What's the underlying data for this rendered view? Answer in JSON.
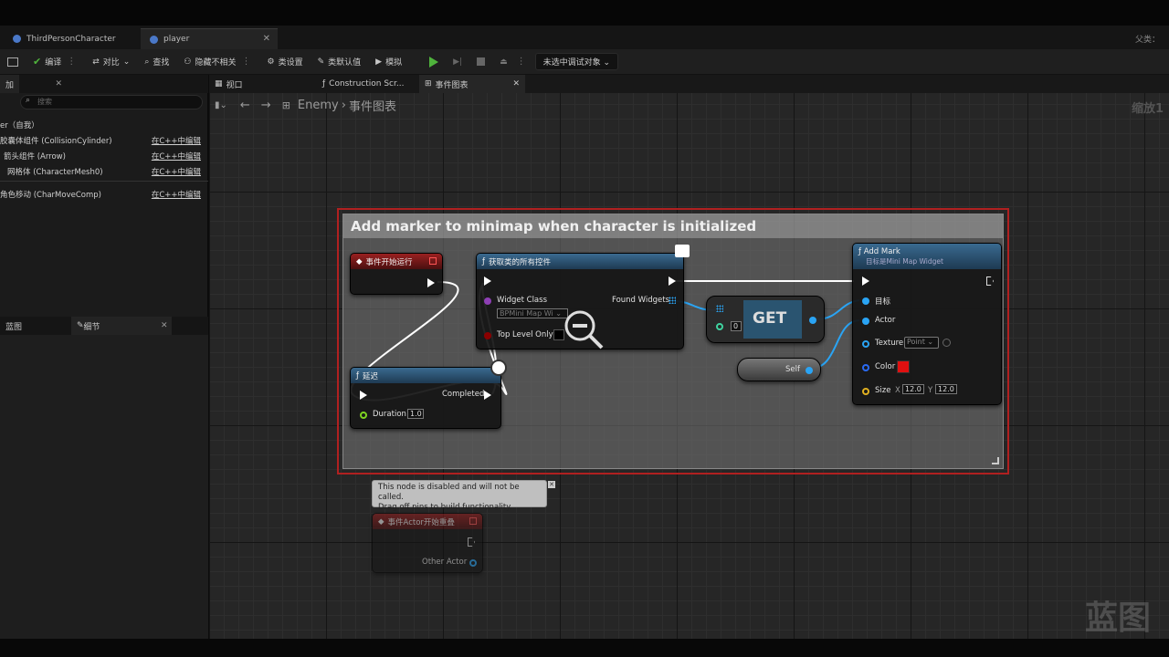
{
  "doc_tabs": [
    {
      "label": "ThirdPersonCharacter"
    },
    {
      "label": "player"
    }
  ],
  "top_right_label": "父类：",
  "toolbar": {
    "compile": "编译",
    "diff": "对比",
    "find": "查找",
    "hide_unrelated": "隐藏不相关",
    "class_settings": "类设置",
    "class_defaults": "类默认值",
    "simulate": "模拟",
    "debug_target": "未选中调试对象"
  },
  "components_panel": {
    "add_label": "加",
    "search_placeholder": "搜索",
    "root": "er（自我）",
    "items": [
      {
        "name": "胶囊体组件 (CollisionCylinder)",
        "edit": "在C++中编辑"
      },
      {
        "name": "箭头组件 (Arrow)",
        "edit": "在C++中编辑"
      },
      {
        "name": "网格体 (CharacterMesh0)",
        "edit": "在C++中编辑"
      },
      {
        "name": "角色移动 (CharMoveComp)",
        "edit": "在C++中编辑"
      }
    ]
  },
  "lower_panel": {
    "tab1": "蓝图",
    "tab2": "细节"
  },
  "graph_tabs": [
    {
      "label": "视口"
    },
    {
      "label": "Construction Scr..."
    },
    {
      "label": "事件图表"
    }
  ],
  "breadcrumb": {
    "root": "Enemy",
    "current": "事件图表"
  },
  "zoom": "缩放1",
  "comment": {
    "title": "Add marker to minimap when character is initialized"
  },
  "nodes": {
    "begin_play": {
      "title": "事件开始运行"
    },
    "get_widgets": {
      "title": "获取类的所有控件",
      "widget_class_label": "Widget Class",
      "widget_class_value": "BPMini Map Wi",
      "top_level_label": "Top Level Only",
      "found_label": "Found Widgets"
    },
    "get": {
      "label": "GET",
      "index": "0"
    },
    "delay": {
      "title": "延迟",
      "completed": "Completed",
      "duration_label": "Duration",
      "duration_value": "1.0"
    },
    "self": {
      "label": "Self"
    },
    "add_mark": {
      "title": "Add Mark",
      "subtitle": "目标是Mini Map Widget",
      "target": "目标",
      "actor": "Actor",
      "texture": "Texture",
      "texture_value": "Point",
      "color": "Color",
      "size": "Size",
      "size_x": "12.0",
      "size_y": "12.0",
      "color_value": "#e01010"
    },
    "overlap": {
      "title": "事件Actor开始重叠",
      "other_actor": "Other Actor"
    }
  },
  "tooltip": {
    "line1": "This node is disabled and will not be called.",
    "line2": "Drag off pins to build functionality."
  },
  "watermark": "蓝图",
  "colors": {
    "accent_red": "#b02020",
    "exec_white": "#ffffff",
    "object_pin": "#2aa4f4",
    "float_pin": "#7ed321"
  }
}
